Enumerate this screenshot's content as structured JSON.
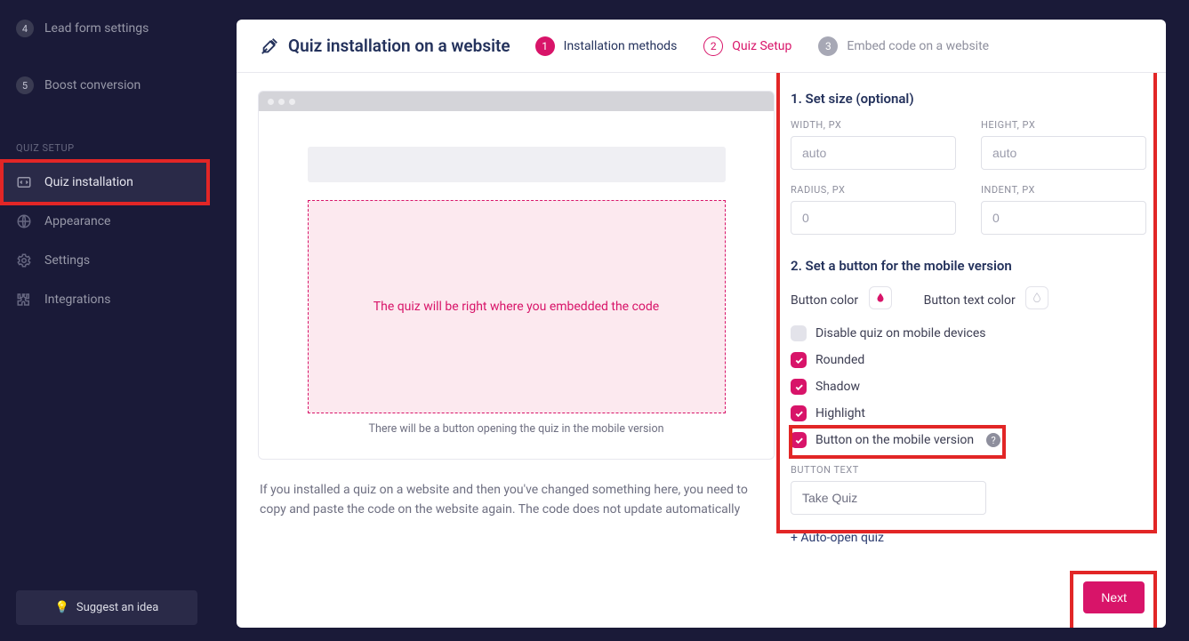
{
  "sidebar": {
    "steps": [
      {
        "num": "4",
        "label": "Lead form settings"
      },
      {
        "num": "5",
        "label": "Boost conversion"
      }
    ],
    "section": "QUIZ SETUP",
    "items": [
      {
        "label": "Quiz installation",
        "active": true
      },
      {
        "label": "Appearance"
      },
      {
        "label": "Settings"
      },
      {
        "label": "Integrations"
      }
    ],
    "suggest": "Suggest an idea"
  },
  "header": {
    "title": "Quiz installation on a website",
    "steps": [
      {
        "num": "1",
        "label": "Installation methods"
      },
      {
        "num": "2",
        "label": "Quiz Setup"
      },
      {
        "num": "3",
        "label": "Embed code on a website"
      }
    ]
  },
  "preview": {
    "dashed_text": "The quiz will be right where you embedded the code",
    "hint": "There will be a button opening the quiz in the mobile version",
    "note": "If you installed a quiz on a website and then you've changed something here, you need to copy and paste the code on the website again. The code does not update automatically"
  },
  "settings": {
    "h1": "1. Set size (optional)",
    "width_lbl": "WIDTH, PX",
    "width_ph": "auto",
    "height_lbl": "HEIGHT, PX",
    "height_ph": "auto",
    "radius_lbl": "RADIUS, PX",
    "radius_ph": "0",
    "indent_lbl": "INDENT, PX",
    "indent_ph": "0",
    "h2": "2. Set a button for the mobile version",
    "btn_color": "Button color",
    "btn_text_color": "Button text color",
    "checks": {
      "disable": "Disable quiz on mobile devices",
      "rounded": "Rounded",
      "shadow": "Shadow",
      "highlight": "Highlight",
      "mobile": "Button on the mobile version"
    },
    "btn_text_lbl": "BUTTON TEXT",
    "btn_text_val": "Take Quiz",
    "auto_open": "+ Auto-open quiz",
    "next": "Next"
  }
}
